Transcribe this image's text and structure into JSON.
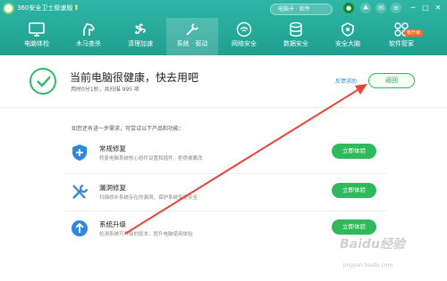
{
  "app": {
    "title": "360安全卫士极速版"
  },
  "search": {
    "placeholder": "电脑卡 · 软件"
  },
  "nav": {
    "items": [
      {
        "label": "电脑体检",
        "icon": "monitor-icon"
      },
      {
        "label": "木马查杀",
        "icon": "horse-icon"
      },
      {
        "label": "清理加速",
        "icon": "fan-icon"
      },
      {
        "label": "系统 · 驱动",
        "icon": "wrench-icon"
      },
      {
        "label": "网络安全",
        "icon": "wifi-icon"
      },
      {
        "label": "数据安全",
        "icon": "database-icon"
      },
      {
        "label": "安全大脑",
        "icon": "brain-icon"
      },
      {
        "label": "软件管家",
        "icon": "apps-icon"
      }
    ],
    "active_index": 3,
    "badge": "有升级"
  },
  "status": {
    "title": "当前电脑很健康，快去用吧",
    "subtitle": "用时0分1秒，共扫描 995 项",
    "feedback": "反馈求助",
    "back": "返回"
  },
  "hint": "如您还有进一步需求，可尝试以下产品和功能：",
  "cards": [
    {
      "title": "常规修复",
      "desc": "修复电脑系统核心组件设置和插件，拒绝被篡改",
      "button": "立即体验",
      "icon": "shield-plus-icon",
      "color": "#2e86e0"
    },
    {
      "title": "漏洞修复",
      "desc": "扫描修补系统存在的漏洞，保护系统免受安全",
      "button": "立即体验",
      "icon": "tools-icon",
      "color": "#2e86e0"
    },
    {
      "title": "系统升级",
      "desc": "检测系统可升级的版本，提升电脑使用体验",
      "button": "立即体验",
      "icon": "upgrade-icon",
      "color": "#2e86e0"
    }
  ],
  "watermark": {
    "text": "Baidu经验",
    "sub": "jingyan.baidu.com"
  },
  "colors": {
    "accent": "#1fa58f",
    "green": "#2fb95c",
    "link": "#2c8cd8",
    "annotation": "#e8443a"
  }
}
